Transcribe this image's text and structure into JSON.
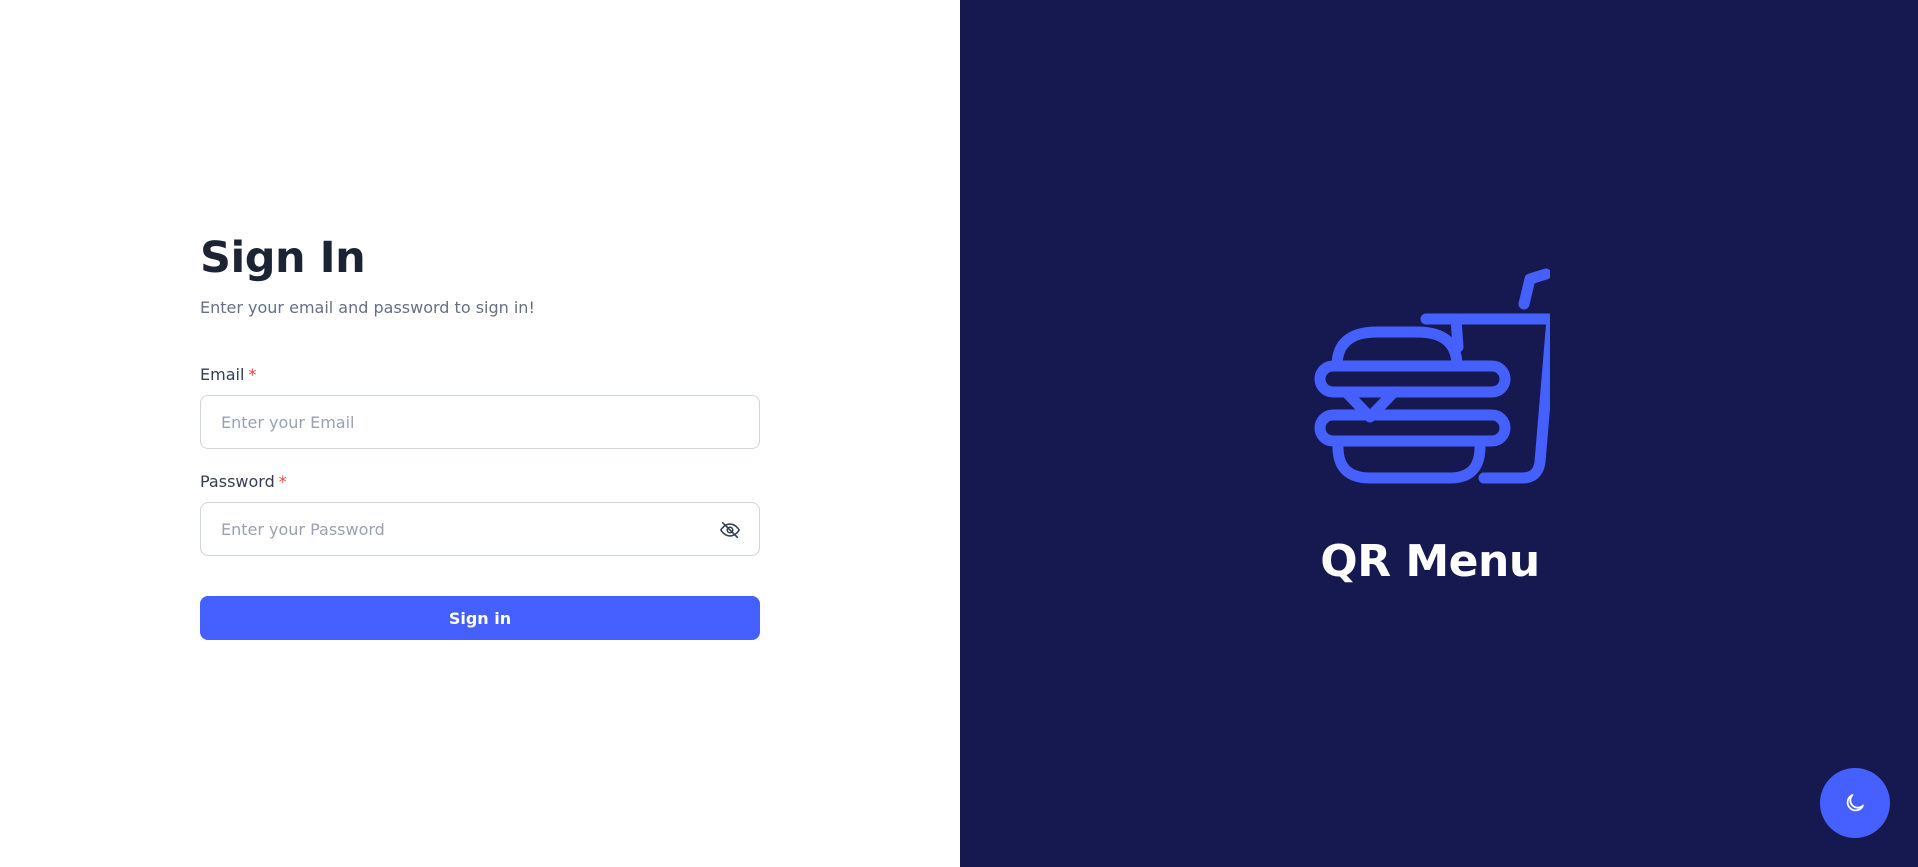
{
  "login": {
    "title": "Sign In",
    "subtitle": "Enter your email and password to sign in!",
    "email_label": "Email",
    "email_placeholder": "Enter your Email",
    "email_value": "",
    "password_label": "Password",
    "password_placeholder": "Enter your Password",
    "password_value": "",
    "required_marker": "*",
    "toggle_visibility_icon": "eye-off-icon",
    "submit_label": "Sign in"
  },
  "brand": {
    "name": "QR Menu",
    "logo_icon": "burger-and-drink-icon"
  },
  "theme_toggle": {
    "icon": "moon-icon"
  },
  "colors": {
    "accent": "#465fff",
    "brand_panel_bg": "#161950",
    "heading_text": "#1c2434",
    "muted_text": "#667085",
    "required_marker": "#f04438",
    "input_border": "#d0d5dd",
    "placeholder": "#98a2b3"
  }
}
